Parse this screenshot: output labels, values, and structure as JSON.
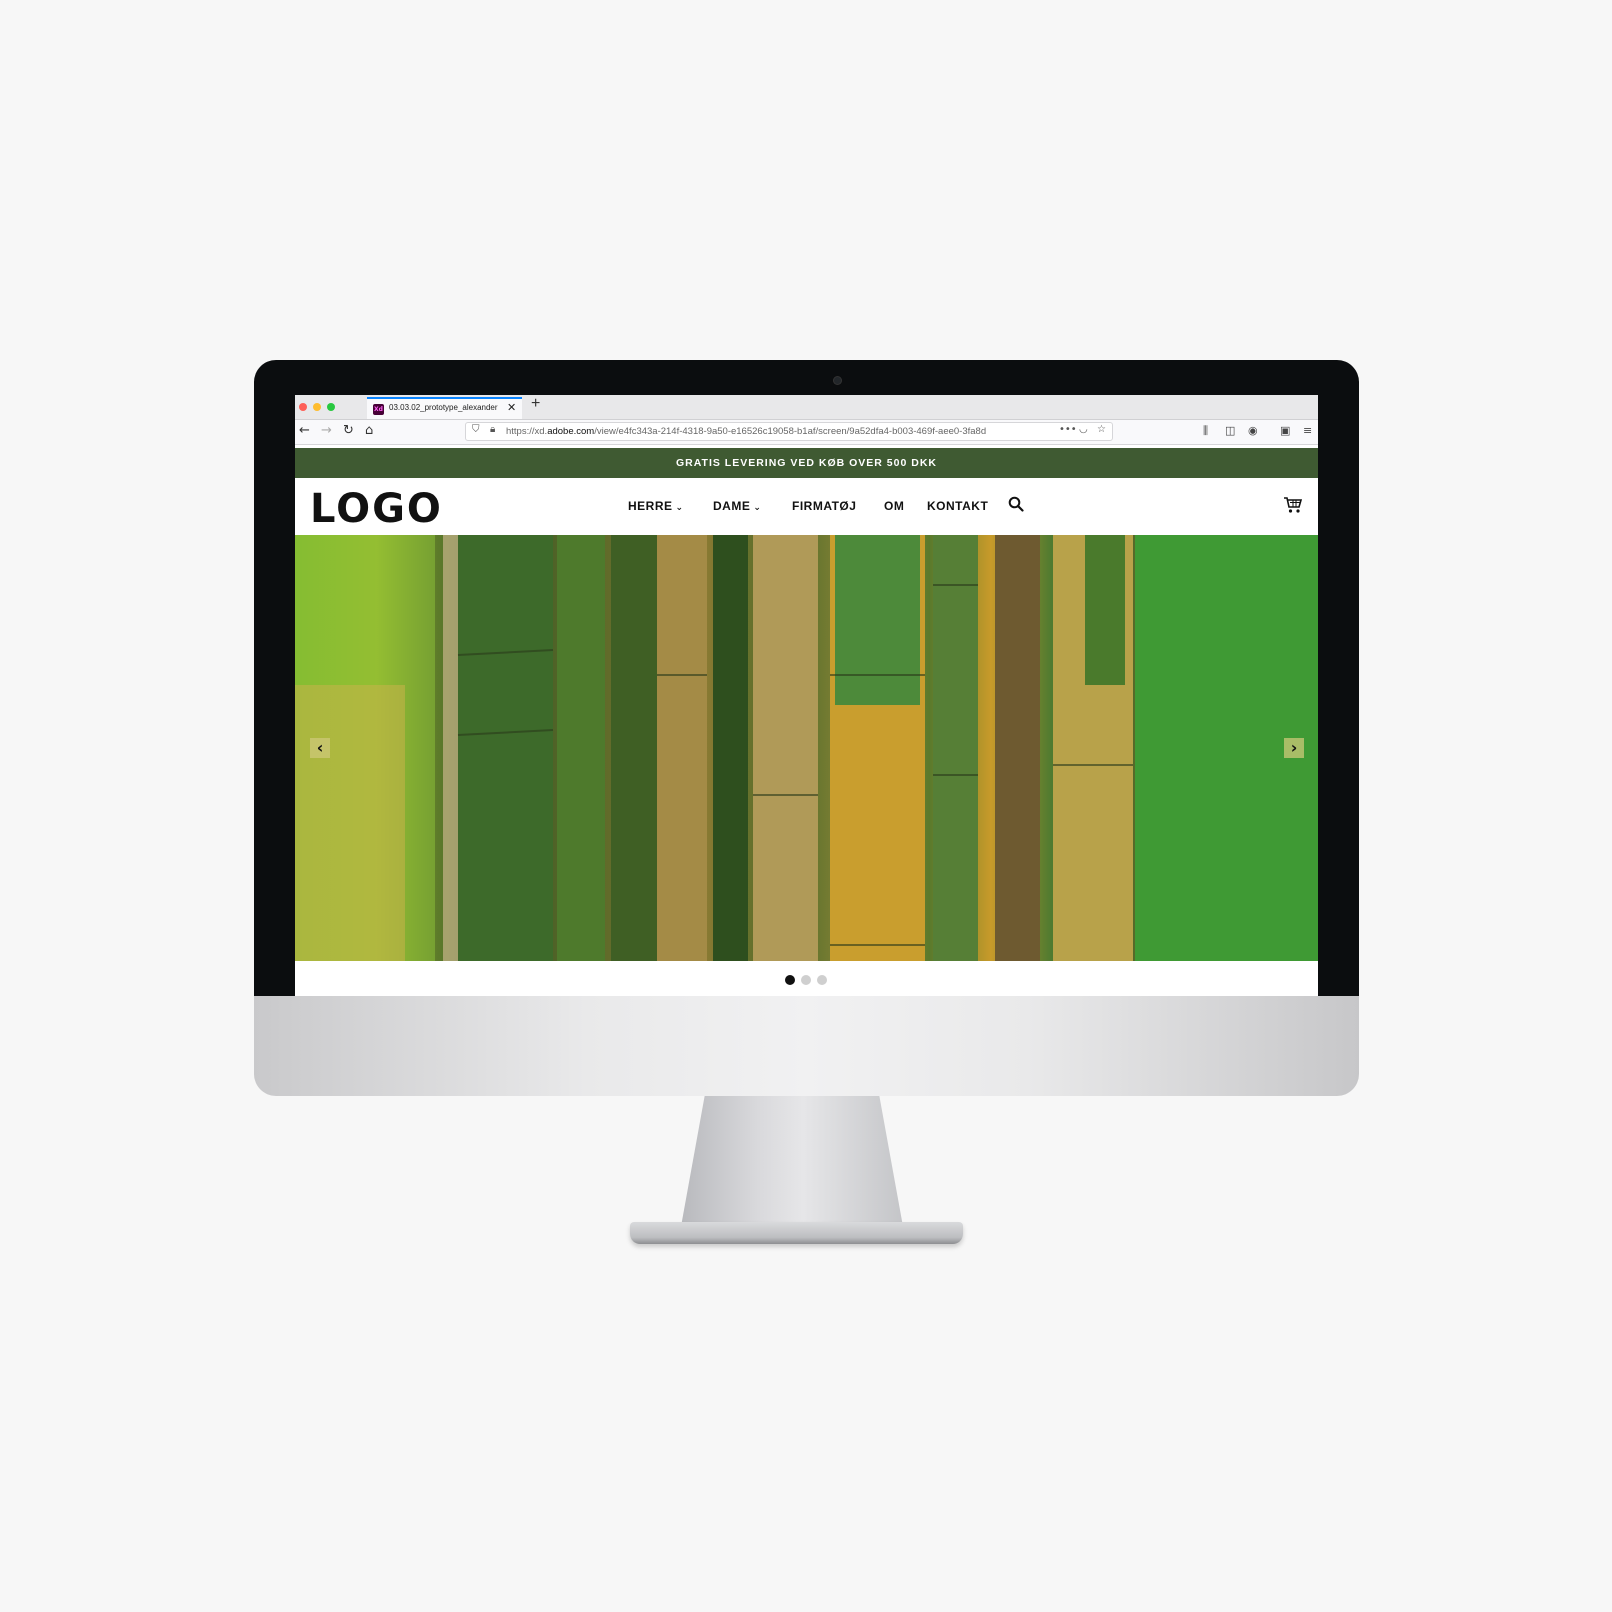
{
  "browser": {
    "tab_title": "03.03.02_prototype_alexander",
    "favicon_text": "Xd",
    "url_prefix": "https://xd.",
    "url_domain": "adobe.com",
    "url_rest": "/view/e4fc343a-214f-4318-9a50-e16526c19058-b1af/screen/9a52dfa4-b003-469f-aee0-3fa8d",
    "icons": [
      "back-icon",
      "forward-icon",
      "reload-icon",
      "home-icon",
      "shield-icon",
      "lock-icon",
      "more-icon",
      "pocket-icon",
      "bookmark-star-icon",
      "library-icon",
      "sidebar-icon",
      "account-icon",
      "extension-icon",
      "menu-icon"
    ]
  },
  "site": {
    "promo_text": "GRATIS LEVERING VED KØB OVER 500 DKK",
    "logo": "LOGO",
    "menu": [
      {
        "label": "HERRE",
        "dropdown": true
      },
      {
        "label": "DAME",
        "dropdown": true
      },
      {
        "label": "FIRMATØJ",
        "dropdown": false
      },
      {
        "label": "OM",
        "dropdown": false
      },
      {
        "label": "KONTAKT",
        "dropdown": false
      }
    ],
    "hero_image": "bamboo-forest",
    "slider": {
      "arrow_prev": "‹",
      "arrow_next": "›",
      "total": 3,
      "active": 1
    }
  },
  "colors": {
    "promo_bg": "#3f5a32",
    "active_dot": "#111111",
    "inactive_dot": "#cfcfcf"
  }
}
